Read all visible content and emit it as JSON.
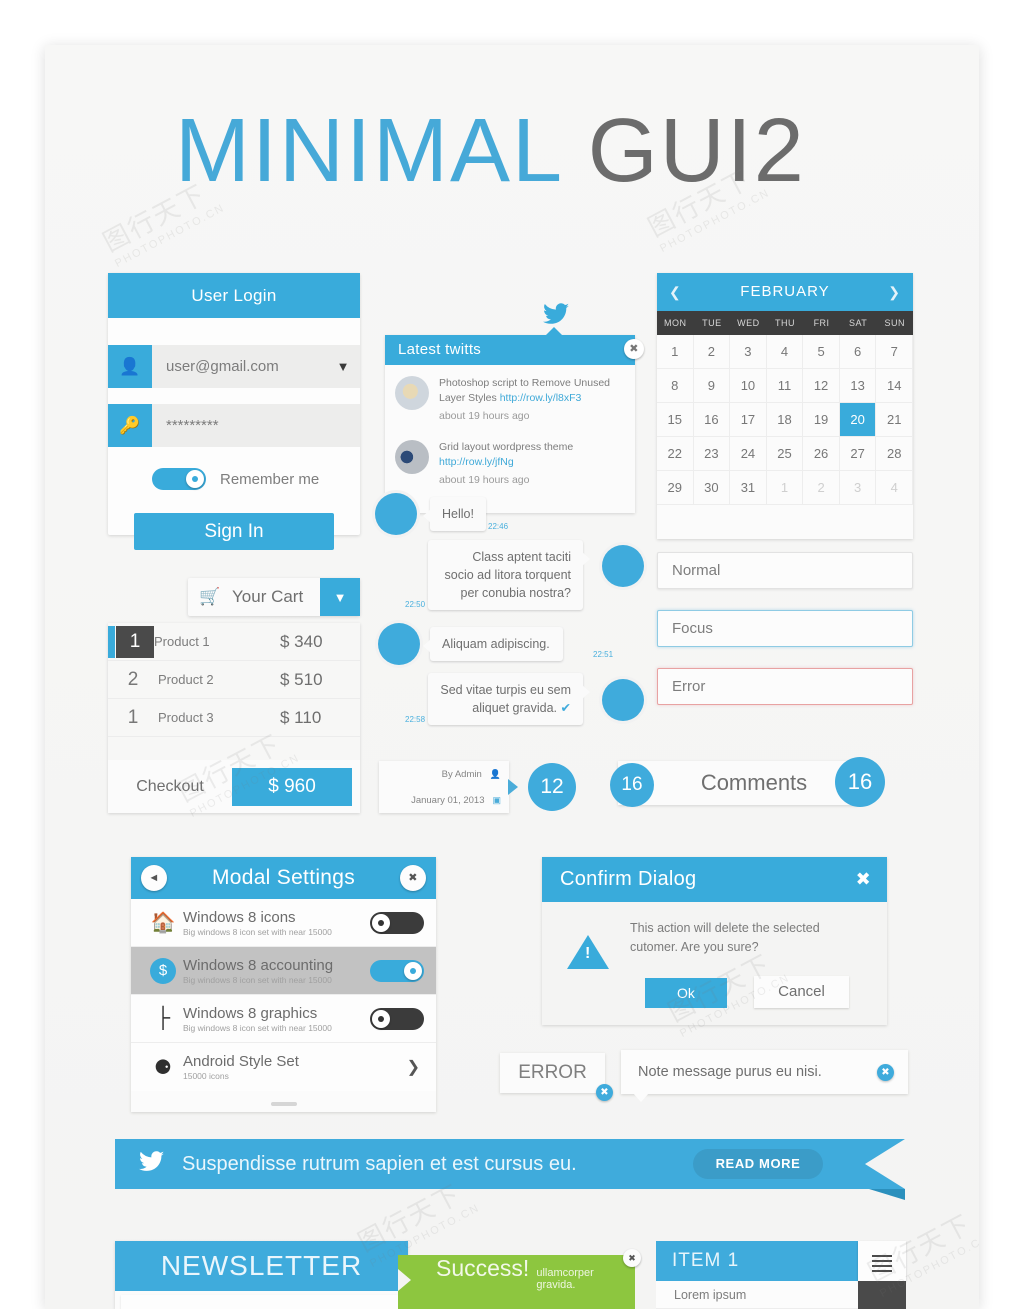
{
  "title": {
    "blue": "MINIMAL",
    "gray": "GUI2"
  },
  "colors": {
    "accent": "#39abdb",
    "accent_light": "#3fabdc",
    "dark": "#3d3d3d",
    "success": "#8dc63f",
    "error": "#e8a2a2",
    "page_bg": "#f4f4f3"
  },
  "login": {
    "header": "User Login",
    "username_value": "user@gmail.com",
    "password_value": "*********",
    "remember_label": "Remember me",
    "remember_on": true,
    "signin_label": "Sign In",
    "user_icon": "person-icon",
    "key_icon": "key-icon",
    "chevron_icon": "chevron-down-icon"
  },
  "cart": {
    "button_label": "Your Cart",
    "cart_icon": "shopping-cart-icon",
    "dropdown_icon": "chevron-down-icon",
    "items": [
      {
        "qty": "1",
        "name": "Product 1",
        "price": "$ 340",
        "selected": true
      },
      {
        "qty": "2",
        "name": "Product 2",
        "price": "$ 510",
        "selected": false
      },
      {
        "qty": "1",
        "name": "Product 3",
        "price": "$ 110",
        "selected": false
      }
    ],
    "checkout_label": "Checkout",
    "total": "$ 960"
  },
  "twitter_panel": {
    "bird_icon": "twitter-bird-icon",
    "header": "Latest twitts",
    "close_icon": "close-icon",
    "tweets": [
      {
        "text": "Photoshop script to Remove Unused Layer Styles ",
        "link": "http://row.ly/l8xF3",
        "ago": "about 19 hours ago"
      },
      {
        "text": "Grid layout wordpress theme ",
        "link": "http://row.ly/jfNg",
        "ago": "about 19 hours ago"
      }
    ]
  },
  "chat": {
    "messages": [
      {
        "text": "Hello!",
        "time": "22:46",
        "side": "left"
      },
      {
        "text": "Class aptent taciti socio ad litora torquent per conubia nostra?",
        "time": "22:50",
        "side": "right"
      },
      {
        "text": "Aliquam adipiscing.",
        "time": "22:51",
        "side": "left"
      },
      {
        "text": "Sed vitae turpis eu sem aliquet gravida.",
        "time": "22:58",
        "side": "right",
        "check": "✔"
      }
    ]
  },
  "calendar": {
    "month": "FEBRUARY",
    "prev_icon": "chevron-left-icon",
    "next_icon": "chevron-right-icon",
    "weekdays": [
      "MON",
      "TUE",
      "WED",
      "THU",
      "FRI",
      "SAT",
      "SUN"
    ],
    "days": [
      1,
      2,
      3,
      4,
      5,
      6,
      7,
      8,
      9,
      10,
      11,
      12,
      13,
      14,
      15,
      16,
      17,
      18,
      19,
      20,
      21,
      22,
      23,
      24,
      25,
      26,
      27,
      28,
      29,
      30,
      31
    ],
    "selected_day": 20,
    "trailing_days": [
      1,
      2,
      3,
      4
    ]
  },
  "fields": {
    "normal": "Normal",
    "focus": "Focus",
    "error": "Error"
  },
  "meta": {
    "author": "By Admin",
    "author_icon": "person-icon",
    "date": "January 01, 2013",
    "date_icon": "calendar-icon",
    "count_badge": "12",
    "comments_badge": "16",
    "comments_label": "Comments",
    "bubble_badge": "16"
  },
  "modal": {
    "title": "Modal Settings",
    "back_icon": "chevron-left-icon",
    "close_icon": "close-icon",
    "rows": [
      {
        "icon": "home-icon",
        "title": "Windows 8 icons",
        "subtitle": "Big windows 8 icon set with near 15000",
        "toggle": "off",
        "selected": false
      },
      {
        "icon": "dollar-coin-icon",
        "title": "Windows 8 accounting",
        "subtitle": "Big windows 8 icon set with near 15000",
        "toggle": "on",
        "selected": true
      },
      {
        "icon": "node-graph-icon",
        "title": "Windows 8 graphics",
        "subtitle": "Big windows 8 icon set with near 15000",
        "toggle": "off",
        "selected": false
      },
      {
        "icon": "palette-icon",
        "title": "Android Style Set",
        "subtitle": "15000 icons",
        "toggle": "chevron",
        "selected": false
      }
    ]
  },
  "confirm": {
    "title": "Confirm Dialog",
    "close_icon": "close-icon",
    "warning_icon": "warning-triangle-icon",
    "message": "This action will delete the selected cutomer. Are you sure?",
    "ok_label": "Ok",
    "cancel_label": "Cancel"
  },
  "error_label": {
    "text": "ERROR",
    "close_icon": "close-circle-icon"
  },
  "note": {
    "text": "Note message purus eu nisi.",
    "close_icon": "close-circle-icon"
  },
  "ribbon": {
    "twitter_icon": "twitter-bird-icon",
    "text": "Suspendisse rutrum sapien et est cursus eu.",
    "button_label": "READ MORE"
  },
  "newsletter": {
    "title": "NEWSLETTER"
  },
  "success": {
    "strong": "Success!",
    "text": "ullamcorper gravida.",
    "close_icon": "close-icon"
  },
  "select": {
    "label": "ITEM 1",
    "chevron_icon": "chevron-down-icon",
    "menu_icon": "hamburger-icon",
    "options": [
      "Lorem ipsum"
    ]
  },
  "watermarks": [
    "图行天下",
    "PHOTOPHOTO.CN"
  ]
}
